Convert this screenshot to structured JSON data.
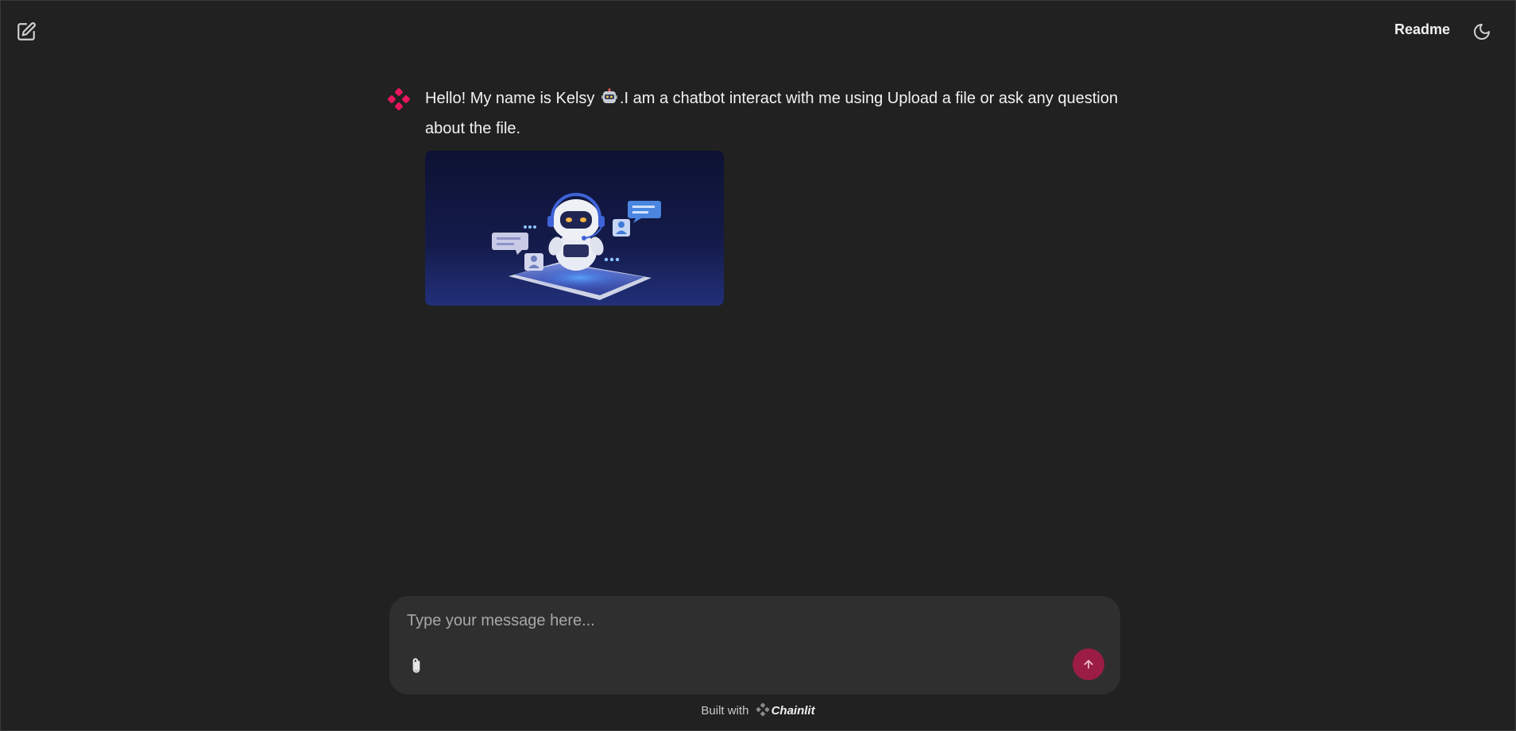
{
  "header": {
    "readme_label": "Readme",
    "new_chat_icon": "edit-icon",
    "theme_icon": "moon-icon"
  },
  "message": {
    "author_icon": "chainlit-logo-icon",
    "text_before_emoji": "Hello! My name is Kelsy ",
    "emoji_icon": "robot-icon",
    "text_after_emoji": ".I am a chatbot interact with me using Upload a file or ask any question about the file.",
    "image_icon": "chatbot-illustration"
  },
  "composer": {
    "placeholder": "Type your message here...",
    "value": "",
    "attach_icon": "paperclip-icon",
    "send_icon": "arrow-up-icon"
  },
  "footer": {
    "built_with": "Built with",
    "brand": "Chainlit"
  },
  "colors": {
    "background": "#212121",
    "composer_bg": "#2f2f2f",
    "accent": "#e8155f",
    "send_button": "#9b1c45"
  }
}
